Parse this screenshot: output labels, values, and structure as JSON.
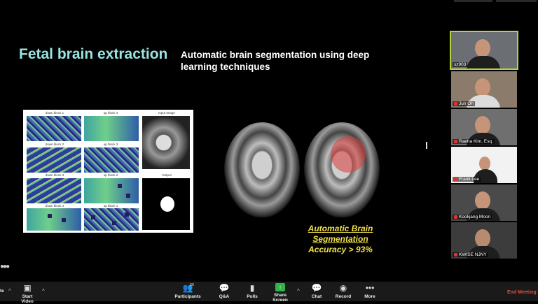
{
  "slide": {
    "title": "Fetal brain extraction",
    "subtitle": "Automatic brain segmentation using deep learning techniques",
    "figure_labels": [
      "down block 1",
      "up block 4",
      "Input Image",
      "down block 2",
      "up block 3",
      "down block 3",
      "up block 2",
      "Output",
      "down block 4",
      "up block 1"
    ],
    "accuracy_title": "Automatic Brain Segmentation",
    "accuracy_value": "Accuracy > 93%",
    "accent_color": "#9be3e0",
    "highlight_color": "#f2e14a"
  },
  "participants": [
    {
      "name": "sz903",
      "muted": false,
      "active": true
    },
    {
      "name": "Jun Oh",
      "muted": true,
      "active": false
    },
    {
      "name": "Raeha Kim, Esq.",
      "muted": true,
      "active": false
    },
    {
      "name": "Frank Lee",
      "muted": true,
      "active": false
    },
    {
      "name": "Kookjang Moon",
      "muted": true,
      "active": false
    },
    {
      "name": "KWISE NJNY",
      "muted": true,
      "active": false
    }
  ],
  "toolbar": {
    "start_video": "Start Video",
    "participants": "Participants",
    "participants_count": "56",
    "qa": "Q&A",
    "polls": "Polls",
    "share_screen": "Share Screen",
    "chat": "Chat",
    "record": "Record",
    "more": "More",
    "end_meeting": "End Meeting",
    "edge_label": "te"
  }
}
